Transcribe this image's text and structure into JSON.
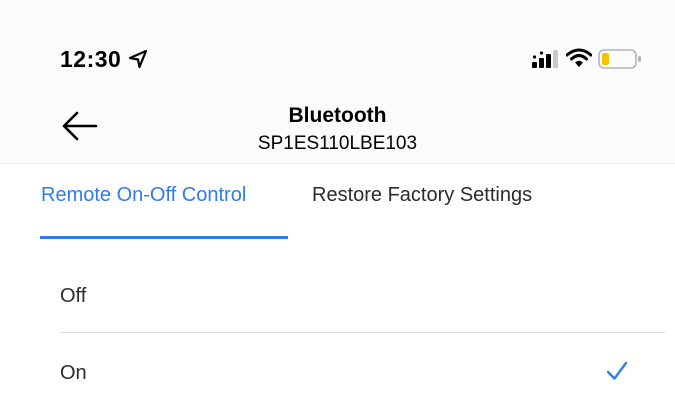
{
  "status_bar": {
    "time": "12:30",
    "icons": [
      "location-arrow-icon",
      "cellular-signal-icon",
      "wifi-icon",
      "battery-low-icon"
    ]
  },
  "header": {
    "title": "Bluetooth",
    "subtitle": "SP1ES110LBE103",
    "back_icon": "back-arrow-icon"
  },
  "tabs": [
    {
      "label": "Remote On-Off Control",
      "active": true
    },
    {
      "label": "Restore Factory Settings",
      "active": false
    }
  ],
  "options": [
    {
      "label": "Off",
      "selected": false
    },
    {
      "label": "On",
      "selected": true
    }
  ],
  "colors": {
    "accent": "#2f7bf0",
    "battery_level": "#f5c400",
    "text": "#2b2b2b",
    "header_bg": "#fbfbfb"
  }
}
